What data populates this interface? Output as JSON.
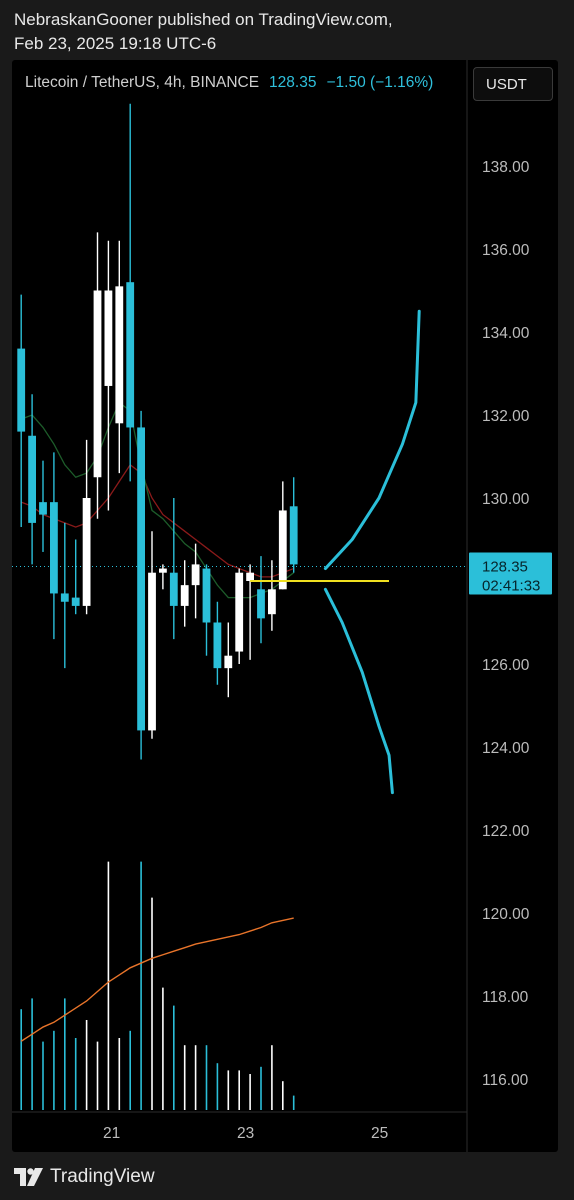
{
  "header": {
    "published_line": "NebraskanGooner published on TradingView.com,",
    "date_line": "Feb 23, 2025 19:18 UTC-6"
  },
  "legend": {
    "symbol": "Litecoin / TetherUS, 4h, BINANCE",
    "price": "128.35",
    "change": "−1.50 (−1.16%)"
  },
  "currency_button": "USDT",
  "price_tag": {
    "price": "128.35",
    "countdown": "02:41:33"
  },
  "footer": {
    "brand": "TradingView",
    "logo_icon": "tradingview-logo-icon"
  },
  "colors": {
    "up": "#ffffff",
    "down": "#2bbfd9",
    "ma_red": "#8b1a1a",
    "ma_green": "#1d5c2a",
    "volume_ma": "#e8742a",
    "forecast": "#2bbfd9",
    "level_line": "#f0e020",
    "price_line": "#2bbfd9"
  },
  "chart_data": {
    "type": "candlestick",
    "y_ticks": [
      "138.00",
      "136.00",
      "134.00",
      "132.00",
      "130.00",
      "126.00",
      "124.00",
      "122.00",
      "120.00",
      "118.00",
      "116.00"
    ],
    "ylim": [
      115.2,
      139.8
    ],
    "x_ticks": [
      "21",
      "23",
      "25"
    ],
    "current_price": 128.35,
    "candles": [
      {
        "o": 133.6,
        "c": 131.6,
        "h": 134.9,
        "l": 129.3
      },
      {
        "o": 131.5,
        "c": 129.4,
        "h": 132.5,
        "l": 128.4
      },
      {
        "o": 129.9,
        "c": 129.6,
        "h": 130.9,
        "l": 128.7
      },
      {
        "o": 129.9,
        "c": 127.7,
        "h": 131.1,
        "l": 126.6
      },
      {
        "o": 127.7,
        "c": 127.5,
        "h": 129.4,
        "l": 125.9
      },
      {
        "o": 127.6,
        "c": 127.4,
        "h": 129.0,
        "l": 127.2
      },
      {
        "o": 127.4,
        "c": 130.0,
        "h": 131.4,
        "l": 127.2
      },
      {
        "o": 130.5,
        "c": 135.0,
        "h": 136.4,
        "l": 129.5
      },
      {
        "o": 132.7,
        "c": 135.0,
        "h": 136.2,
        "l": 129.7
      },
      {
        "o": 131.8,
        "c": 135.1,
        "h": 136.2,
        "l": 130.6
      },
      {
        "o": 135.2,
        "c": 131.7,
        "h": 139.5,
        "l": 130.4
      },
      {
        "o": 131.7,
        "c": 124.4,
        "h": 132.1,
        "l": 123.7
      },
      {
        "o": 124.4,
        "c": 128.2,
        "h": 129.2,
        "l": 124.2
      },
      {
        "o": 128.2,
        "c": 128.3,
        "h": 128.4,
        "l": 127.8
      },
      {
        "o": 128.2,
        "c": 127.4,
        "h": 130.0,
        "l": 126.6
      },
      {
        "o": 127.4,
        "c": 127.9,
        "h": 128.5,
        "l": 126.9
      },
      {
        "o": 127.9,
        "c": 128.4,
        "h": 128.9,
        "l": 127.1
      },
      {
        "o": 128.3,
        "c": 127.0,
        "h": 128.4,
        "l": 126.2
      },
      {
        "o": 127.0,
        "c": 125.9,
        "h": 127.5,
        "l": 125.5
      },
      {
        "o": 125.9,
        "c": 126.2,
        "h": 127.0,
        "l": 125.2
      },
      {
        "o": 126.3,
        "c": 128.2,
        "h": 128.3,
        "l": 126.0
      },
      {
        "o": 128.0,
        "c": 128.2,
        "h": 128.4,
        "l": 126.1
      },
      {
        "o": 127.8,
        "c": 127.1,
        "h": 128.6,
        "l": 126.5
      },
      {
        "o": 127.2,
        "c": 127.8,
        "h": 128.5,
        "l": 126.8
      },
      {
        "o": 127.8,
        "c": 129.7,
        "h": 130.4,
        "l": 127.8
      },
      {
        "o": 129.8,
        "c": 128.4,
        "h": 130.5,
        "l": 128.2
      }
    ],
    "volume": [
      2.8,
      3.1,
      1.9,
      2.2,
      3.1,
      2.0,
      2.5,
      1.9,
      6.9,
      2.0,
      2.2,
      6.9,
      5.9,
      3.4,
      2.9,
      1.8,
      1.8,
      1.8,
      1.3,
      1.1,
      1.1,
      1.0,
      1.2,
      1.8,
      0.8,
      0.4
    ],
    "volume_ma": [
      2.9,
      3.2,
      3.5,
      3.7,
      4.0,
      4.3,
      4.6,
      5.0,
      5.4,
      5.7,
      6.0,
      6.2,
      6.4,
      6.55,
      6.7,
      6.85,
      7.0,
      7.1,
      7.2,
      7.3,
      7.4,
      7.55,
      7.7,
      7.9,
      8.0,
      8.1
    ],
    "ma_red": [
      129.9,
      129.8,
      129.6,
      129.5,
      129.4,
      129.3,
      129.4,
      129.7,
      130.0,
      130.4,
      130.8,
      130.6,
      130.0,
      129.6,
      129.4,
      129.2,
      129.0,
      128.8,
      128.6,
      128.4,
      128.3,
      128.2,
      128.1,
      128.1,
      128.2,
      128.3
    ],
    "ma_green": [
      131.9,
      132.0,
      131.7,
      131.3,
      130.8,
      130.5,
      130.6,
      131.0,
      131.7,
      132.3,
      132.1,
      130.8,
      129.7,
      129.5,
      129.2,
      128.9,
      128.7,
      128.3,
      127.9,
      127.6,
      127.6,
      127.6,
      127.7,
      127.8,
      128.0,
      128.2
    ],
    "level": 128.0,
    "forecast_upper": [
      [
        24.2,
        128.3
      ],
      [
        24.6,
        129.0
      ],
      [
        25.0,
        130.0
      ],
      [
        25.35,
        131.3
      ],
      [
        25.55,
        132.3
      ],
      [
        25.6,
        134.5
      ]
    ],
    "forecast_lower": [
      [
        24.2,
        127.8
      ],
      [
        24.45,
        127.0
      ],
      [
        24.75,
        125.8
      ],
      [
        25.0,
        124.5
      ],
      [
        25.15,
        123.8
      ],
      [
        25.2,
        122.9
      ]
    ]
  }
}
